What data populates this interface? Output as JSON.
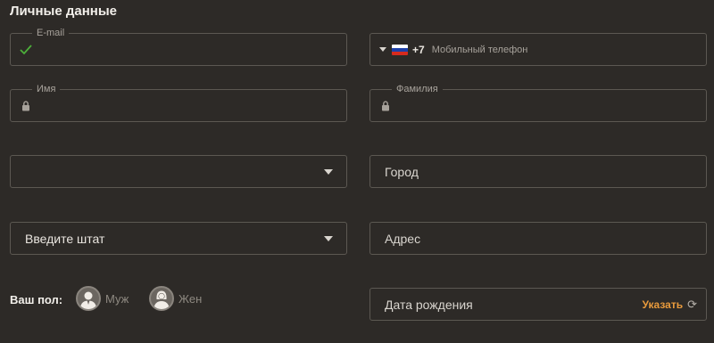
{
  "section_title": "Личные данные",
  "email": {
    "label": "E-mail",
    "value": "",
    "status_icon": "check-icon",
    "status_color": "#4caf3a"
  },
  "phone": {
    "country_code": "+7",
    "placeholder": "Мобильный телефон",
    "flag_icon": "russia-flag-icon"
  },
  "first_name": {
    "label": "Имя",
    "value": "",
    "icon": "lock-icon"
  },
  "last_name": {
    "label": "Фамилия",
    "value": "",
    "icon": "lock-icon"
  },
  "country_select": {
    "value": ""
  },
  "city": {
    "placeholder": "Город"
  },
  "state_select": {
    "value": "Введите штат"
  },
  "address": {
    "placeholder": "Адрес"
  },
  "gender": {
    "label": "Ваш пол:",
    "options": [
      {
        "label": "Муж",
        "icon": "male-avatar-icon"
      },
      {
        "label": "Жен",
        "icon": "female-avatar-icon"
      }
    ]
  },
  "birth_date": {
    "placeholder": "Дата рождения",
    "action_label": "Указать",
    "action_icon": "refresh-icon"
  },
  "colors": {
    "accent": "#e89a3c",
    "background": "#2d2a27",
    "border": "#5c5852"
  }
}
